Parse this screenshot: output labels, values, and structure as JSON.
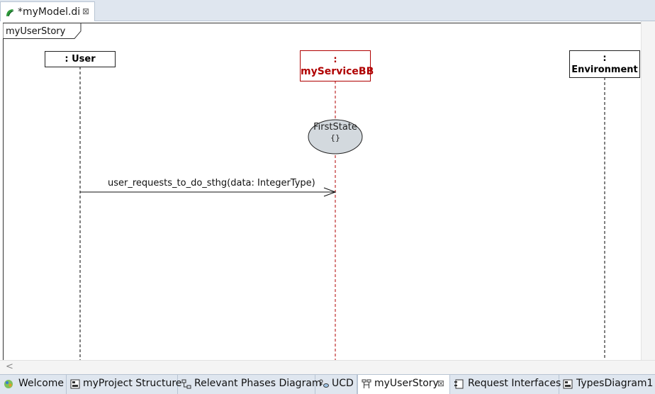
{
  "editor_tab": {
    "title": "*myModel.di",
    "close_glyph": "⊠",
    "icon": "papyrus-logo-icon"
  },
  "diagram": {
    "frame_label": "myUserStory",
    "lifelines": [
      {
        "name": ": User",
        "color": "#000000"
      },
      {
        "name_top": ":",
        "name_bottom": "myServiceBB",
        "color": "#b00000"
      },
      {
        "name_top": ":",
        "name_bottom": "Environment",
        "color": "#000000"
      }
    ],
    "state_invariant": {
      "name": "FirstState",
      "constraint": "{}"
    },
    "message": {
      "label": "user_requests_to_do_sthg(data: IntegerType)"
    }
  },
  "hscroll": {
    "left_glyph": "<"
  },
  "bottom_tabs": [
    {
      "label": "Welcome",
      "icon": "welcome-icon",
      "active": false
    },
    {
      "label": "myProject Structure",
      "icon": "class-diagram-icon",
      "active": false
    },
    {
      "label": "Relevant Phases Diagram",
      "icon": "activity-diagram-icon",
      "active": false
    },
    {
      "label": "UCD",
      "icon": "use-case-diagram-icon",
      "active": false
    },
    {
      "label": "myUserStory",
      "icon": "sequence-diagram-icon",
      "active": true,
      "close": "⊠"
    },
    {
      "label": "Request Interfaces",
      "icon": "component-diagram-icon",
      "active": false
    },
    {
      "label": "TypesDiagram1",
      "icon": "class-diagram-icon",
      "active": false
    }
  ],
  "colors": {
    "lifeline_user": "#000000",
    "lifeline_service": "#b00000",
    "state_fill": "#d3d9de"
  }
}
